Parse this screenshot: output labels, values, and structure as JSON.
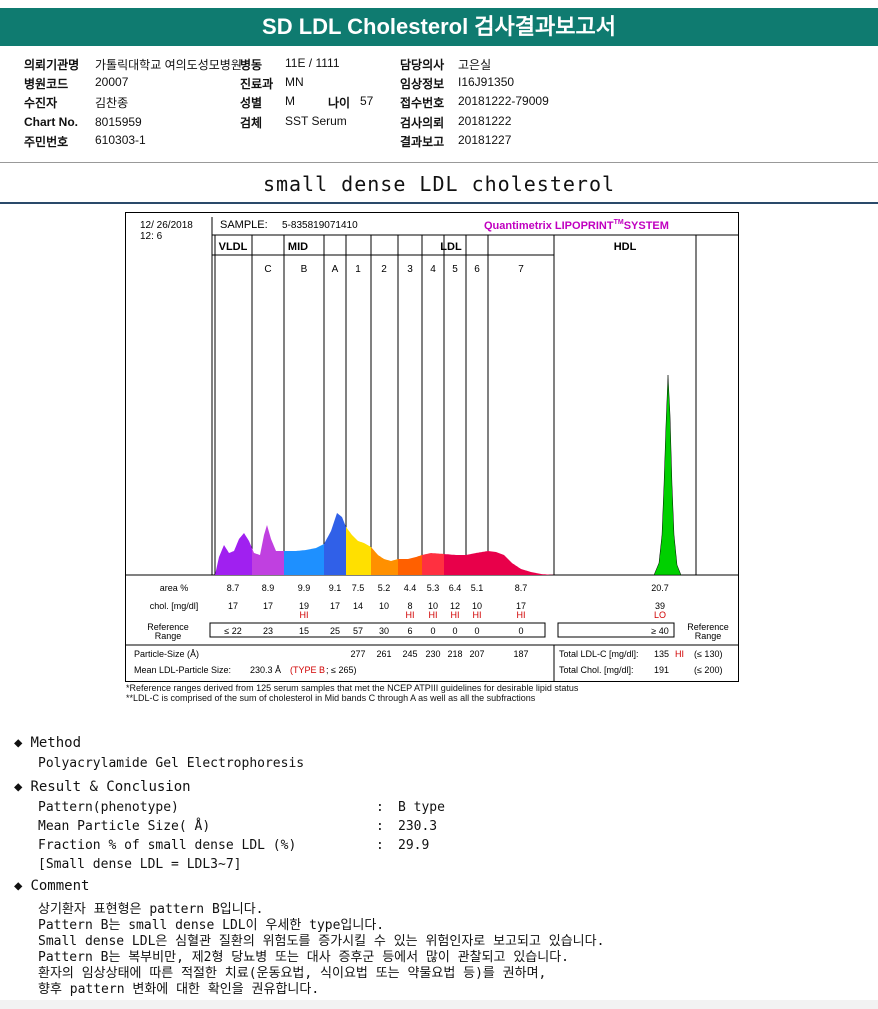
{
  "header": {
    "title": "SD LDL Cholesterol 검사결과보고서"
  },
  "info": {
    "col1": [
      {
        "label": "의뢰기관명",
        "value": "가톨릭대학교 여의도성모병원"
      },
      {
        "label": "병원코드",
        "value": "20007"
      },
      {
        "label": "수진자",
        "value": "김찬종"
      },
      {
        "label": "Chart No.",
        "value": "8015959"
      },
      {
        "label": "주민번호",
        "value": "610303-1"
      }
    ],
    "col2": [
      {
        "label": "병동",
        "value": "11E / 1111"
      },
      {
        "label": "진료과",
        "value": "MN"
      },
      {
        "label": "성별",
        "value": "M"
      },
      {
        "label": "검체",
        "value": "SST Serum"
      }
    ],
    "age": {
      "label": "나이",
      "value": "57"
    },
    "col3": [
      {
        "label": "담당의사",
        "value": "고은실"
      },
      {
        "label": "임상정보",
        "value": "I16J91350"
      },
      {
        "label": "접수번호",
        "value": "20181222-79009"
      },
      {
        "label": "검사의뢰",
        "value": "20181222"
      },
      {
        "label": "결과보고",
        "value": "20181227"
      }
    ]
  },
  "section_title": "small dense LDL cholesterol",
  "chart": {
    "date": "12/ 26/2018",
    "time": "12: 6",
    "sample_label": "SAMPLE:",
    "sample_id": "5-835819071410",
    "brand": "Quantimetrix LIPOPRINT",
    "brand_tm": "TM",
    "brand_suffix": "SYSTEM",
    "groups": {
      "vldl": "VLDL",
      "mid": "MID",
      "ldl": "LDL",
      "hdl": "HDL"
    },
    "colors": {
      "vldl": "#a020f0",
      "midc": "#c040e0",
      "midb": "#1e90ff",
      "mida": "#3060e8",
      "ldl1": "#ffe000",
      "ldl2": "#ff9000",
      "ldl3": "#ff6000",
      "ldl4": "#ff3040",
      "ldl5": "#e8004a",
      "ldl6": "#e8004a",
      "ldl7": "#e8004a",
      "hdl": "#00d000",
      "hi": "#d00000"
    },
    "row_labels": {
      "area": "area %",
      "chol": "chol. [mg/dl]",
      "ref": "Reference",
      "ref2": "Range",
      "ref_right": "Reference",
      "ref_right2": "Range",
      "psize": "Particle-Size (Å)",
      "mean": "Mean LDL-Particle Size:",
      "total_ldl": "Total LDL-C [mg/dl]:",
      "total_chol": "Total Chol. [mg/dl]:"
    }
  },
  "chart_data": {
    "type": "area",
    "fractions": [
      {
        "name": "VLDL",
        "area": "8.7",
        "chol": "17",
        "flag": "",
        "ref": "≤ 22",
        "size": ""
      },
      {
        "name": "C",
        "area": "8.9",
        "chol": "17",
        "flag": "",
        "ref": "23",
        "size": ""
      },
      {
        "name": "B",
        "area": "9.9",
        "chol": "19",
        "flag": "HI",
        "ref": "15",
        "size": ""
      },
      {
        "name": "A",
        "area": "9.1",
        "chol": "17",
        "flag": "",
        "ref": "25",
        "size": ""
      },
      {
        "name": "1",
        "area": "7.5",
        "chol": "14",
        "flag": "",
        "ref": "57",
        "size": "277"
      },
      {
        "name": "2",
        "area": "5.2",
        "chol": "10",
        "flag": "",
        "ref": "30",
        "size": "261"
      },
      {
        "name": "3",
        "area": "4.4",
        "chol": "8",
        "flag": "HI",
        "ref": "6",
        "size": "245"
      },
      {
        "name": "4",
        "area": "5.3",
        "chol": "10",
        "flag": "HI",
        "ref": "0",
        "size": "230"
      },
      {
        "name": "5",
        "area": "6.4",
        "chol": "12",
        "flag": "HI",
        "ref": "0",
        "size": "218"
      },
      {
        "name": "6",
        "area": "5.1",
        "chol": "10",
        "flag": "HI",
        "ref": "0",
        "size": "207"
      },
      {
        "name": "7",
        "area": "8.7",
        "chol": "17",
        "flag": "HI",
        "ref": "0",
        "size": "187"
      },
      {
        "name": "HDL",
        "area": "20.7",
        "chol": "39",
        "flag": "LO",
        "ref": "≥ 40",
        "size": ""
      }
    ],
    "mean_size": "230.3 Å",
    "type_label": "(TYPE B",
    "type_ref": "; ≤ 265)",
    "total_ldl": "135",
    "total_ldl_flag": "HI",
    "total_ldl_ref": "(≤ 130)",
    "total_chol": "191",
    "total_chol_ref": "(≤ 200)"
  },
  "footnotes": [
    "*Reference ranges derived from 125 serum samples that met the NCEP ATPIII guidelines for desirable lipid status",
    "**LDL-C is comprised of the sum of cholesterol in Mid bands C through A as well as all the subfractions"
  ],
  "method": {
    "title": "Method",
    "text": "Polyacrylamide Gel Electrophoresis"
  },
  "result": {
    "title": "Result & Conclusion",
    "rows": [
      {
        "label": "Pattern(phenotype)",
        "value": "B type"
      },
      {
        "label": "Mean Particle Size( Å)",
        "value": "230.3"
      },
      {
        "label": "Fraction % of small dense LDL (%)",
        "value": "29.9"
      }
    ],
    "note": "[Small dense LDL = LDL3~7]"
  },
  "comment": {
    "title": "Comment",
    "lines": [
      "상기환자 표현형은 pattern B입니다.",
      "Pattern B는 small dense LDL이 우세한 type입니다.",
      "Small dense LDL은 심혈관 질환의 위험도를 증가시킬 수 있는 위험인자로 보고되고 있습니다.",
      "Pattern B는 복부비만, 제2형 당뇨병 또는 대사 증후군 등에서 많이 관찰되고 있습니다.",
      "환자의 임상상태에 따른 적절한 치료(운동요법, 식이요법 또는 약물요법 등)를 권하며,",
      "향후 pattern 변화에 대한 확인을 권유합니다."
    ]
  }
}
